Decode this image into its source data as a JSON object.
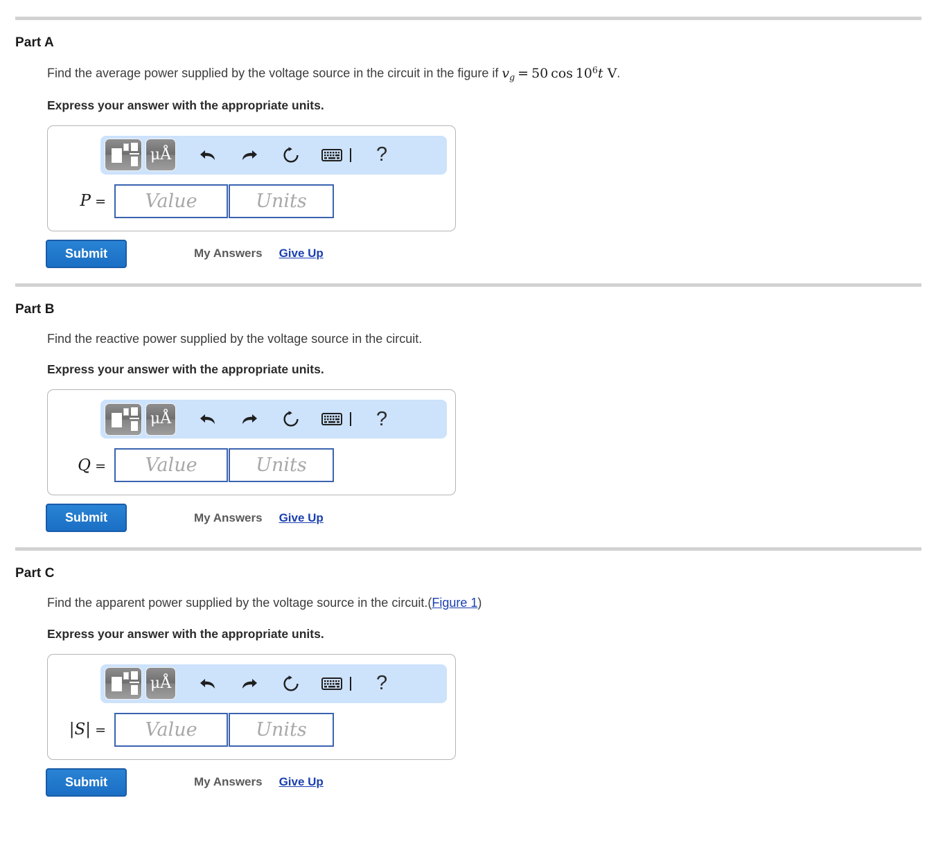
{
  "toolbar": {
    "template_button_title": "math-template",
    "units_button_label": "μÅ",
    "undo_title": "undo",
    "redo_title": "redo",
    "reset_title": "reset",
    "keyboard_title": "keyboard",
    "help_label": "?"
  },
  "fields": {
    "value_placeholder": "Value",
    "units_placeholder": "Units"
  },
  "actions": {
    "submit_label": "Submit",
    "my_answers_label": "My Answers",
    "give_up_label": "Give Up"
  },
  "colors": {
    "toolbar_background": "#cde2fb",
    "field_border": "#3a63b0",
    "submit_background": "#1a6fc4",
    "link": "#1a3fb0",
    "divider": "#d2d2d2",
    "container_border": "#b5b5b5"
  },
  "parts": [
    {
      "title": "Part A",
      "question_prefix": "Find the average power supplied by the voltage source in the circuit in the figure if ",
      "question_suffix": ".",
      "math": {
        "variable": "v",
        "subscript": "g",
        "equals": "=",
        "coefficient": "50",
        "function": "cos",
        "base": "10",
        "exponent": "6",
        "time": "t",
        "unit": "V"
      },
      "express_text": "Express your answer with the appropriate units.",
      "answer_label": "P",
      "answer_label_equals": "="
    },
    {
      "title": "Part B",
      "question_prefix": "Find the reactive power supplied by the voltage source in the circuit.",
      "express_text": "Express your answer with the appropriate units.",
      "answer_label": "Q",
      "answer_label_equals": "="
    },
    {
      "title": "Part C",
      "question_prefix": "Find the apparent power supplied by the voltage source in the circuit.(",
      "figure_link": "Figure 1",
      "question_suffix": ")",
      "express_text": "Express your answer with the appropriate units.",
      "answer_label": "|S|",
      "answer_label_equals": "="
    }
  ]
}
